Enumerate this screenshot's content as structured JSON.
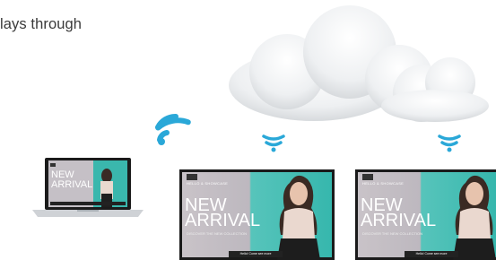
{
  "caption": {
    "partial_top": "",
    "line": "lays through"
  },
  "laptop": {
    "title_line1": "NEW",
    "title_line2": "ARRIVAL"
  },
  "signs": [
    {
      "brand": "HELLO & SHOWCASE",
      "title_line1": "NEW",
      "title_line2": "ARRIVAL",
      "sub": "DISCOVER THE NEW COLLECTION",
      "cta": "Hello! Come see more"
    },
    {
      "brand": "HELLO & SHOWCASE",
      "title_line1": "NEW",
      "title_line2": "ARRIVAL",
      "sub": "DISCOVER THE NEW COLLECTION",
      "cta": "Hello! Come see more"
    }
  ],
  "icons": {
    "cloud": "cloud-icon",
    "wifi": "wifi-icon"
  },
  "colors": {
    "teal": "#36b7ad",
    "wifi_blue": "#2aa8d8",
    "cloud_gray": "#e9ecef"
  }
}
